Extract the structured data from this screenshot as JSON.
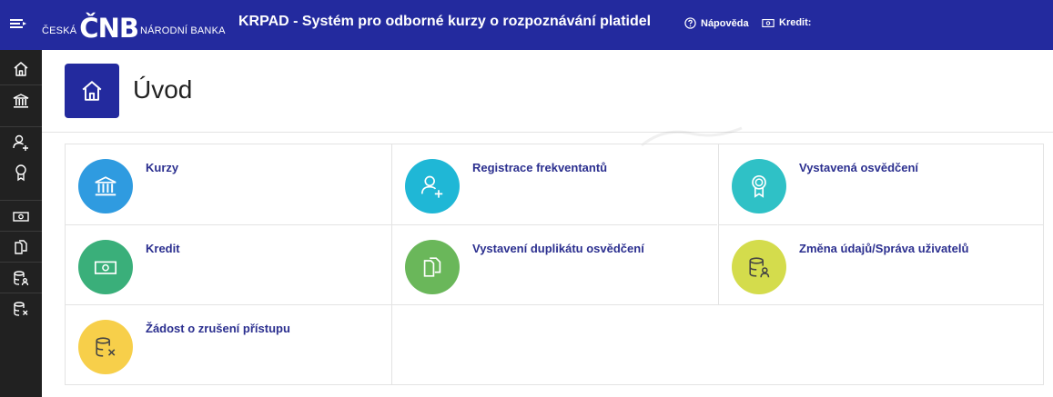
{
  "topbar": {
    "logo_left": "ČESKÁ",
    "logo_main": "ČNB",
    "logo_right": "NÁRODNÍ BANKA",
    "title": "KRPAD - Systém pro odborné kurzy o rozpoznávání platidel",
    "help_label": "Nápověda",
    "credit_label": "Kredit:",
    "background_color": "#232a9e"
  },
  "sidebar": {
    "items": [
      {
        "icon": "home-icon"
      },
      {
        "icon": "bank-icon"
      },
      {
        "icon": "user-add-icon"
      },
      {
        "icon": "award-icon"
      },
      {
        "icon": "banknote-icon"
      },
      {
        "icon": "duplicate-doc-icon"
      },
      {
        "icon": "database-user-icon"
      },
      {
        "icon": "database-remove-icon"
      }
    ],
    "background_color": "#212121"
  },
  "header": {
    "title": "Úvod",
    "icon": "home-icon"
  },
  "tiles": [
    {
      "label": "Kurzy",
      "icon": "bank-icon",
      "color": "#2f9be0"
    },
    {
      "label": "Registrace frekventantů",
      "icon": "user-add-icon",
      "color": "#1fb7d6"
    },
    {
      "label": "Vystavená osvědčení",
      "icon": "award-icon",
      "color": "#2fc1c6"
    },
    {
      "label": "Kredit",
      "icon": "banknote-icon",
      "color": "#3aaf7a"
    },
    {
      "label": "Vystavení duplikátu osvědčení",
      "icon": "duplicate-doc-icon",
      "color": "#6ab75a"
    },
    {
      "label": "Změna údajů/Správa uživatelů",
      "icon": "database-user-icon",
      "color": "#d4dc4c"
    },
    {
      "label": "Žádost o zrušení přístupu",
      "icon": "database-remove-icon",
      "color": "#f7cf4a"
    }
  ]
}
